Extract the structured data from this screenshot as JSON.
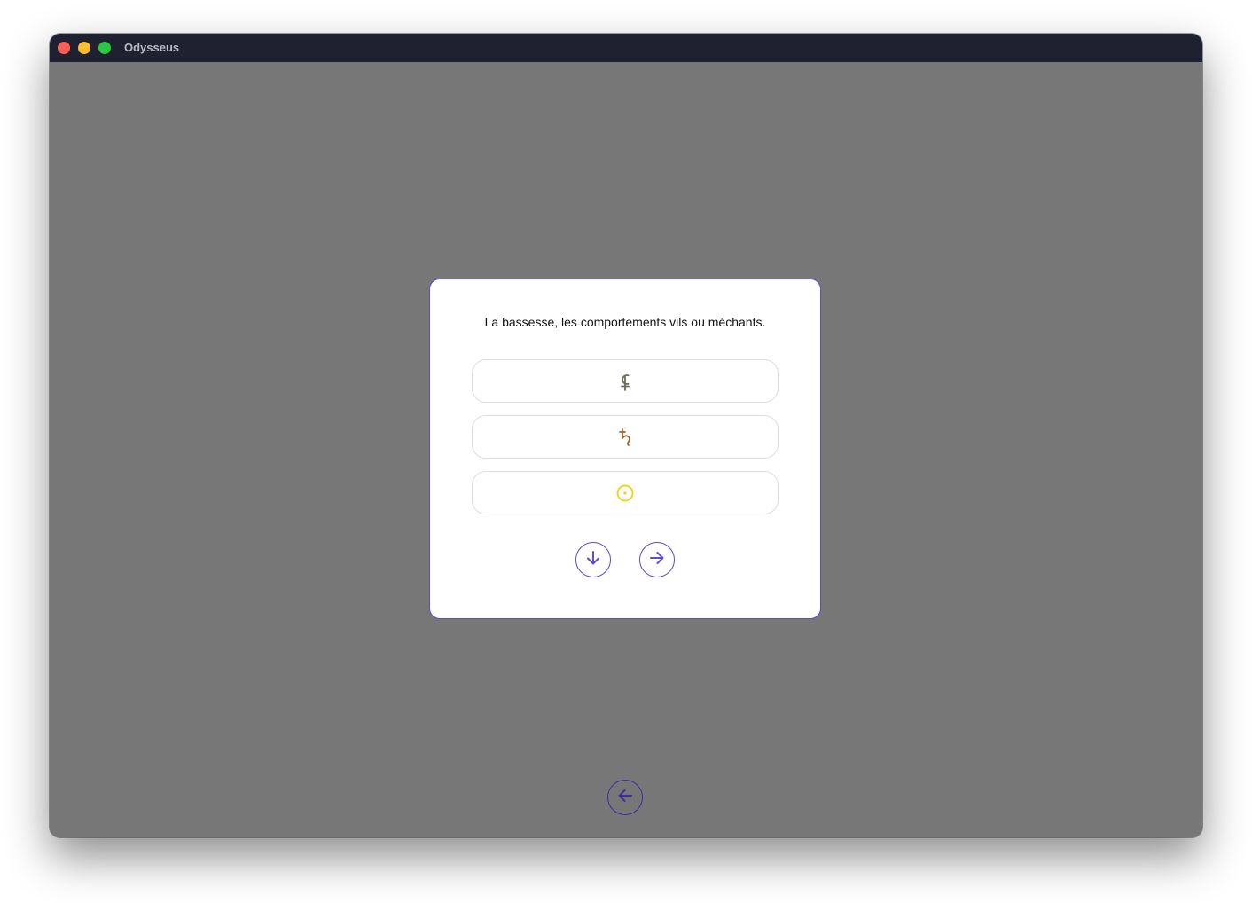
{
  "window": {
    "title": "Odysseus"
  },
  "quiz": {
    "question": "La bassesse, les comportements vils ou méchants.",
    "options": [
      {
        "icon": "ceres-symbol-icon",
        "color": "#6b6b5a"
      },
      {
        "icon": "saturn-symbol-icon",
        "color": "#a0612a"
      },
      {
        "icon": "sun-symbol-icon",
        "color": "#f2d21a"
      }
    ]
  },
  "controls": {
    "down_icon": "arrow-down-icon",
    "next_icon": "arrow-right-icon",
    "back_icon": "arrow-left-icon"
  },
  "colors": {
    "accent": "#5a4bd1",
    "background": "#777777",
    "titlebar": "#1f2130"
  }
}
